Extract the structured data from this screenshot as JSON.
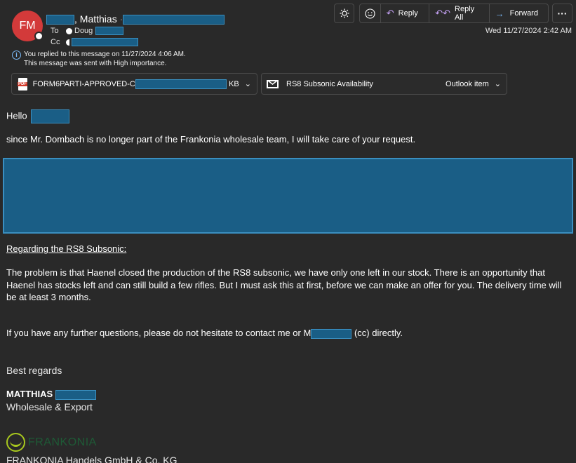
{
  "header": {
    "avatar_initials": "FM",
    "sender_name_suffix": ", Matthias",
    "to_label": "To",
    "to_name": "Doug",
    "cc_label": "Cc",
    "date": "Wed 11/27/2024 2:42 AM"
  },
  "info": {
    "replied": "You replied to this message on 11/27/2024 4:06 AM.",
    "importance": "This message was sent with High importance."
  },
  "toolbar": {
    "reply_label": "Reply",
    "reply_all_label": "Reply All",
    "forward_label": "Forward",
    "more_label": "···"
  },
  "attachments": [
    {
      "name_prefix": "FORM6PARTI-APPROVED-C",
      "size_suffix": "KB",
      "icon": "pdf-file-icon"
    },
    {
      "name": "RS8 Subsonic Availability",
      "type": "Outlook item",
      "icon": "mail-icon"
    }
  ],
  "message": {
    "greeting": "Hello",
    "intro": "since Mr. Dombach is no longer part of the Frankonia wholesale team, I will take care of your request.",
    "section_heading": "Regarding the RS8 Subsonic:",
    "paragraph": "The problem is that Haenel closed the production of the RS8 subsonic, we have only one left in our stock. There is an opportunity that Haenel has stocks left and can still build a few rifles. But I must ask this at first, before we can make an offer for you. The delivery time will be at least 3 months.",
    "questions_prefix": "If you have any further questions, please do not hesitate to contact me or M",
    "questions_suffix": "(cc) directly.",
    "closing": "Best regards",
    "sig_name": "MATTHIAS",
    "sig_role": "Wholesale & Export",
    "logo_text": "FRANKONIA",
    "company": "FRANKONIA Handels GmbH & Co. KG"
  },
  "colors": {
    "background": "#292929",
    "avatar": "#d33a3a",
    "accent_reply": "#c5a2f5",
    "accent_forward": "#7ab8f5",
    "redaction": "#1a5e86",
    "logo_green": "#a8c81e"
  }
}
